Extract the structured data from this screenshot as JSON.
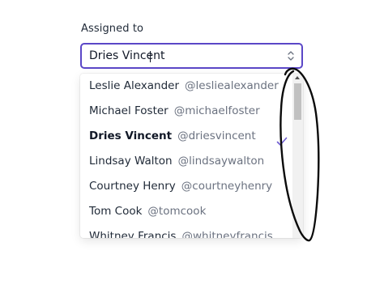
{
  "field": {
    "label": "Assigned to",
    "value": "Dries Vincent",
    "updown_icon": "chevron-up-down-icon"
  },
  "options": [
    {
      "name": "Leslie Alexander",
      "handle": "@lesliealexander",
      "selected": false
    },
    {
      "name": "Michael Foster",
      "handle": "@michaelfoster",
      "selected": false
    },
    {
      "name": "Dries Vincent",
      "handle": "@driesvincent",
      "selected": true
    },
    {
      "name": "Lindsay Walton",
      "handle": "@lindsaywalton",
      "selected": false
    },
    {
      "name": "Courtney Henry",
      "handle": "@courtneyhenry",
      "selected": false
    },
    {
      "name": "Tom Cook",
      "handle": "@tomcook",
      "selected": false
    },
    {
      "name": "Whitney Francis",
      "handle": "@whitneyfrancis",
      "selected": false
    }
  ],
  "colors": {
    "accent": "#5b47c7",
    "check": "#6d5bd0",
    "text": "#1f2937",
    "muted": "#6b7280"
  }
}
